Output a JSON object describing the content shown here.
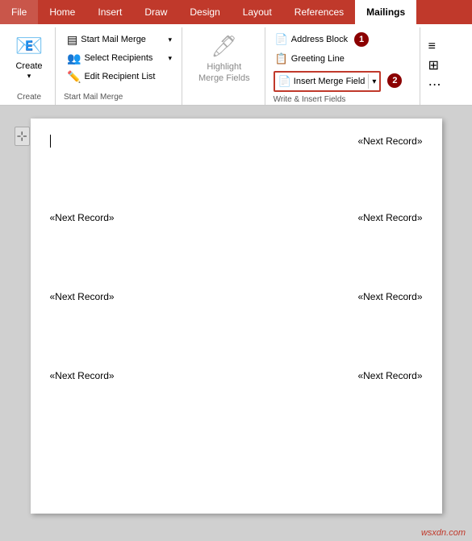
{
  "tabs": [
    {
      "label": "File",
      "active": false
    },
    {
      "label": "Home",
      "active": false
    },
    {
      "label": "Insert",
      "active": false
    },
    {
      "label": "Draw",
      "active": false
    },
    {
      "label": "Design",
      "active": false
    },
    {
      "label": "Layout",
      "active": false
    },
    {
      "label": "References",
      "active": false
    },
    {
      "label": "Mailings",
      "active": true
    }
  ],
  "ribbon": {
    "groups": {
      "create": {
        "label": "Create",
        "button_label": "Create"
      },
      "start_mail_merge": {
        "label": "Start Mail Merge",
        "buttons": [
          {
            "label": "Start Mail Merge",
            "icon": "▤"
          },
          {
            "label": "Select Recipients",
            "icon": "👥"
          },
          {
            "label": "Edit Recipient List",
            "icon": "✏️"
          }
        ]
      },
      "highlight": {
        "label": "Highlight\nMerge Fields",
        "icon": "▣"
      },
      "write_insert": {
        "label": "Write & Insert Fields",
        "buttons": [
          {
            "label": "Address Block",
            "icon": "📄"
          },
          {
            "label": "Greeting Line",
            "icon": "📋"
          }
        ],
        "insert_merge_field": {
          "label": "Insert Merge Field",
          "icon": "📄"
        }
      }
    },
    "badges": {
      "b1": "1",
      "b2": "2"
    }
  },
  "document": {
    "merge_fields": [
      {
        "row": 1,
        "left": "",
        "right": "«Next Record»"
      },
      {
        "row": 2,
        "left": "«Next Record»",
        "right": "«Next Record»"
      },
      {
        "row": 3,
        "left": "«Next Record»",
        "right": "«Next Record»"
      },
      {
        "row": 4,
        "left": "«Next Record»",
        "right": "«Next Record»"
      }
    ]
  },
  "watermark": "wsxdn.com"
}
